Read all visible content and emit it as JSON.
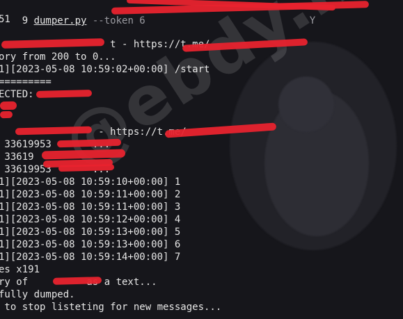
{
  "terminal": {
    "cmd_prefix": "9 ",
    "cmd_file": "dumper.py",
    "cmd_flag": " --token 6",
    "cmd_suffix": "                            Y",
    "lines": [
      "51",
      "",
      "                   t - https://t.me/",
      "ory from 200 to 0...",
      "1][2023-05-08 10:59:02+00:00] /start",
      "=========",
      "ECTED:",
      "",
      "",
      "",
      "                 - https://t.me/",
      " 33619953       ...",
      " 33619",
      " 33619953       ...",
      "1][2023-05-08 10:59:10+00:00] 1",
      "1][2023-05-08 10:59:11+00:00] 2",
      "1][2023-05-08 10:59:11+00:00] 3",
      "1][2023-05-08 10:59:12+00:00] 4",
      "1][2023-05-08 10:59:13+00:00] 5",
      "1][2023-05-08 10:59:13+00:00] 6",
      "1][2023-05-08 10:59:14+00:00] 7",
      "es x191",
      "ry of          as a text...",
      "fully dumped.",
      " to stop listeting for new messages..."
    ]
  },
  "watermark": "@ebdy.net",
  "colors": {
    "background": "#16161b",
    "text": "#e6e6e6",
    "redaction": "#e8232e"
  }
}
